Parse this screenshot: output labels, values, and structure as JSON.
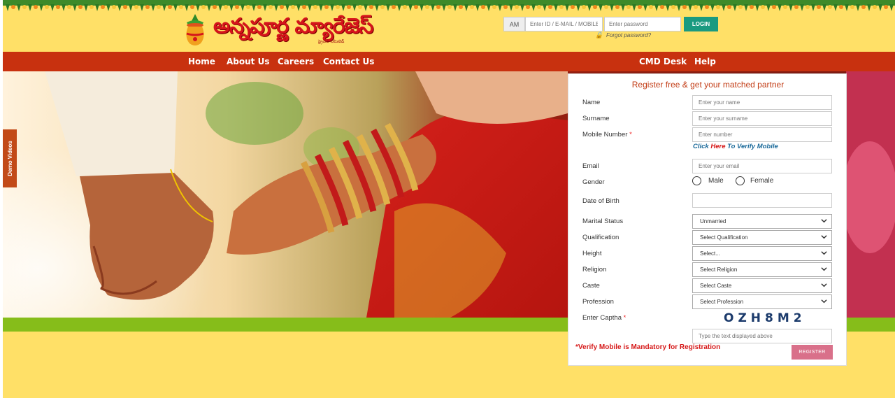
{
  "brand": {
    "logo_text": "అన్నపూర్ణ మ్యారేజెస్",
    "tagline": "ప్రైవేట్ లిమిటెడ్"
  },
  "login": {
    "prefix": "AM",
    "id_placeholder": "Enter ID / E-MAIL / MOBILE",
    "password_placeholder": "Enter password",
    "button": "LOGIN",
    "forgot": "Forgot password?"
  },
  "nav": {
    "left": [
      "Home",
      "About Us",
      "Careers",
      "Contact Us"
    ],
    "right": [
      "CMD Desk",
      "Help"
    ]
  },
  "side_tab": "Demo Videos",
  "form": {
    "title": "Register free & get your matched partner",
    "name_label": "Name",
    "name_placeholder": "Enter your name",
    "surname_label": "Surname",
    "surname_placeholder": "Enter your surname",
    "mobile_label": "Mobile Number",
    "mobile_placeholder": "Enter number",
    "required_mark": "*",
    "verify_click": "Click",
    "verify_here": "Here",
    "verify_rest": "To Verify Mobile",
    "email_label": "Email",
    "email_placeholder": "Enter your email",
    "gender_label": "Gender",
    "gender_options": [
      "Male",
      "Female"
    ],
    "dob_label": "Date of Birth",
    "dob_value": "",
    "marital_label": "Marital Status",
    "marital_value": "Unmarried",
    "qualification_label": "Qualification",
    "qualification_value": "Select Qualification",
    "height_label": "Height",
    "height_value": "Select...",
    "religion_label": "Religion",
    "religion_value": "Select Religion",
    "caste_label": "Caste",
    "caste_value": "Select Caste",
    "profession_label": "Profession",
    "profession_value": "Select Profession",
    "captcha_label": "Enter Captha",
    "captcha_code": "OZH8M2",
    "captcha_placeholder": "Type the text displayed above",
    "mandatory_note": "*Verify Mobile is Mandatory for Registration",
    "register_button": "REGISTER"
  },
  "colors": {
    "page_bg": "#ffe067",
    "nav_bg": "#c8310f",
    "green_band": "#86bd1a",
    "login_button": "#1a9a80",
    "register_button": "#d9708a",
    "form_title": "#c23b14"
  }
}
